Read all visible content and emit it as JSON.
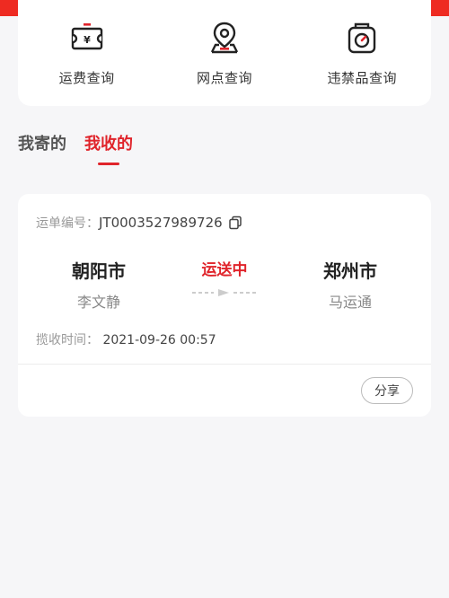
{
  "quick_actions": [
    {
      "label": "运费查询",
      "icon": "freight-ticket-icon"
    },
    {
      "label": "网点查询",
      "icon": "location-pin-icon"
    },
    {
      "label": "违禁品查询",
      "icon": "prohibited-scale-icon"
    }
  ],
  "tabs": [
    {
      "label": "我寄的",
      "active": false
    },
    {
      "label": "我收的",
      "active": true
    }
  ],
  "order": {
    "waybill_label": "运单编号：",
    "waybill_number": "JT0003527989726",
    "from_city": "朝阳市",
    "from_person": "李文静",
    "status": "运送中",
    "to_city": "郑州市",
    "to_person": "马运通",
    "collect_label": "揽收时间：",
    "collect_time": "2021-09-26 00:57",
    "share_label": "分享"
  },
  "colors": {
    "accent": "#e0242b",
    "background": "#f6f6f8",
    "card": "#ffffff"
  }
}
